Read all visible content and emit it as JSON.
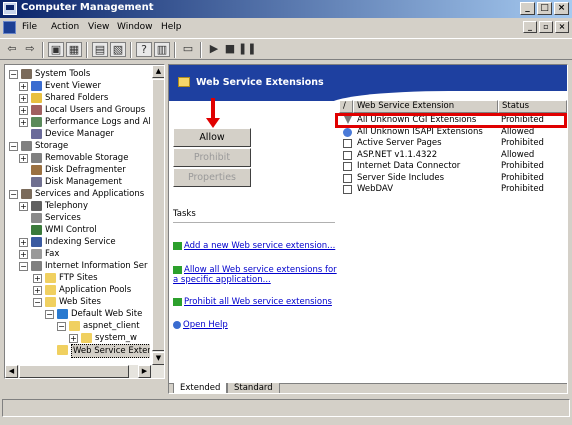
{
  "window": {
    "title": "Computer Management"
  },
  "menu": {
    "items": [
      "File",
      "Action",
      "View",
      "Window",
      "Help"
    ]
  },
  "tree": {
    "items": [
      {
        "label": "System Tools",
        "expander": "−"
      },
      {
        "label": "Event Viewer",
        "expander": "+"
      },
      {
        "label": "Shared Folders",
        "expander": "+"
      },
      {
        "label": "Local Users and Groups",
        "expander": "+"
      },
      {
        "label": "Performance Logs and Al",
        "expander": "+"
      },
      {
        "label": "Device Manager",
        "expander": ""
      },
      {
        "label": "Storage",
        "expander": "−"
      },
      {
        "label": "Removable Storage",
        "expander": "+"
      },
      {
        "label": "Disk Defragmenter",
        "expander": ""
      },
      {
        "label": "Disk Management",
        "expander": ""
      },
      {
        "label": "Services and Applications",
        "expander": "−"
      },
      {
        "label": "Telephony",
        "expander": "+"
      },
      {
        "label": "Services",
        "expander": ""
      },
      {
        "label": "WMI Control",
        "expander": ""
      },
      {
        "label": "Indexing Service",
        "expander": "+"
      },
      {
        "label": "Fax",
        "expander": "+"
      },
      {
        "label": "Internet Information Ser",
        "expander": "−"
      },
      {
        "label": "FTP Sites",
        "expander": "+"
      },
      {
        "label": "Application Pools",
        "expander": "+"
      },
      {
        "label": "Web Sites",
        "expander": "−"
      },
      {
        "label": "Default Web Site",
        "expander": "−"
      },
      {
        "label": "aspnet_client",
        "expander": "−"
      },
      {
        "label": "system_w",
        "expander": "+"
      },
      {
        "label": "Web Service Extensio",
        "expander": ""
      }
    ]
  },
  "right": {
    "title": "Web Service Extensions",
    "buttons": {
      "allow": "Allow",
      "prohibit": "Prohibit",
      "properties": "Properties"
    },
    "tasks_label": "Tasks",
    "tasks": [
      "Add a new Web service extension...",
      "Allow all Web service extensions for a specific application...",
      "Prohibit all Web service extensions",
      "Open Help"
    ],
    "list": {
      "headers": [
        "Web Service Extension",
        "Status"
      ],
      "rows": [
        {
          "name": "All Unknown CGI Extensions",
          "status": "Prohibited"
        },
        {
          "name": "All Unknown ISAPI Extensions",
          "status": "Allowed"
        },
        {
          "name": "Active Server Pages",
          "status": "Prohibited"
        },
        {
          "name": "ASP.NET v1.1.4322",
          "status": "Allowed"
        },
        {
          "name": "Internet Data Connector",
          "status": "Prohibited"
        },
        {
          "name": "Server Side Includes",
          "status": "Prohibited"
        },
        {
          "name": "WebDAV",
          "status": "Prohibited"
        }
      ]
    },
    "tabs": [
      "Extended",
      "Standard"
    ]
  },
  "colors": {
    "highlight": "#e00000",
    "header_bg": "#1e40a0",
    "link": "#0000cc"
  }
}
